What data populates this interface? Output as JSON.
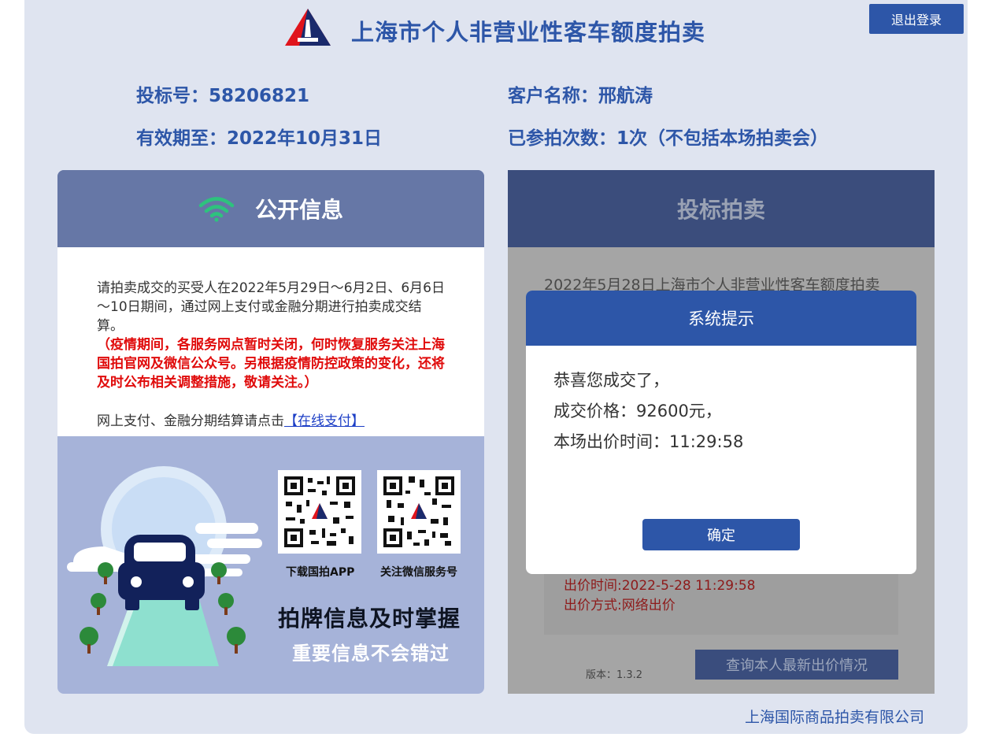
{
  "header": {
    "title": "上海市个人非营业性客车额度拍卖",
    "logout_label": "退出登录"
  },
  "bidder": {
    "bid_number": "投标号：58206821",
    "customer_name": "客户名称：邢航涛",
    "valid_until": "有效期至：2022年10月31日",
    "participation_count": "已参拍次数：1次（不包括本场拍卖会）"
  },
  "public_info": {
    "title": "公开信息",
    "notice_normal": "请拍卖成交的买受人在2022年5月29日～6月2日、6月6日～10日期间，通过网上支付或金融分期进行拍卖成交结算。",
    "notice_red": "（疫情期间，各服务网点暂时关闭，何时恢复服务关注上海国拍官网及微信公众号。另根据疫情防控政策的变化，还将及时公布相关调整措施，敬请关注。）",
    "pay_prefix": "网上支付、金融分期结算请点击",
    "pay_link": "【在线支付】",
    "qr_app_caption": "下载国拍APP",
    "qr_wechat_caption": "关注微信服务号",
    "slogan_main": "拍牌信息及时掌握",
    "slogan_sub": "重要信息不会错过"
  },
  "bidding": {
    "title": "投标拍卖",
    "auction_text": "2022年5月28日上海市个人非营业性客车额度拍卖",
    "bid_time": "出价时间:2022-5-28 11:29:58",
    "bid_method": "出价方式:网络出价",
    "version": "版本：1.3.2",
    "query_label": "查询本人最新出价情况"
  },
  "dialog": {
    "title": "系统提示",
    "line1": "恭喜您成交了，",
    "line2": "成交价格：92600元，",
    "line3": "本场出价时间：11:29:58",
    "ok_label": "确定"
  },
  "footer": {
    "company": "上海国际商品拍卖有限公司"
  },
  "colors": {
    "brand_blue": "#2d56a8",
    "notice_red": "#e00b0b",
    "wifi_green": "#2ec27e"
  }
}
